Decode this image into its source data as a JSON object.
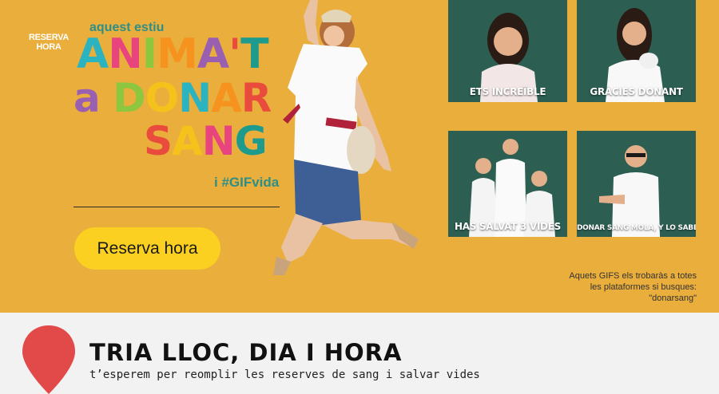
{
  "hero": {
    "tagline": "aquest estiu",
    "headline": {
      "line1": [
        "A",
        "N",
        "I",
        "M",
        "A",
        "'",
        "T"
      ],
      "line2": [
        "a",
        " ",
        "D",
        "O",
        "N",
        "A",
        "R"
      ],
      "line3": [
        "S",
        "A",
        "N",
        "G"
      ]
    },
    "hashtag": "i #GIFvida",
    "cta_label": "Reserva hora"
  },
  "gifs": [
    {
      "caption": "ETS INCREÏBLE"
    },
    {
      "caption": "GRÀCIES DONANT"
    },
    {
      "caption": "HAS SALVAT 3 VIDES"
    },
    {
      "caption": "DONAR SANG MOLA, Y LO SABES..."
    }
  ],
  "gif_note": "Aquets GIFS els trobaràs a totes les plataformes si busques: \"donarsang\"",
  "booking": {
    "pin_label_line1": "RESERVA",
    "pin_label_line2": "HORA",
    "title": "TRIA LLOC, DIA I HORA",
    "subtitle": "t’esperem per reomplir les reserves de sang i salvar vides"
  },
  "colors": {
    "hero_bg": "#e9ae3c",
    "cta_bg": "#fbd021",
    "gif_bg": "#2c5f52",
    "pin_red": "#e24a4a"
  }
}
